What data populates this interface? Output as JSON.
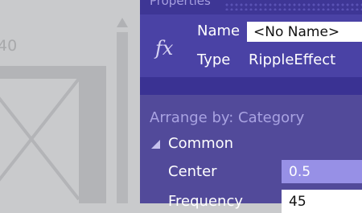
{
  "artboard": {
    "ruler_number": "40"
  },
  "panel": {
    "title": "Properties",
    "icon": "fx",
    "name_label": "Name",
    "name_value": "<No Name>",
    "type_label": "Type",
    "type_value": "RippleEffect",
    "arrange_by": "Arrange by: Category",
    "group": "Common",
    "properties": [
      {
        "label": "Center",
        "value": "0.5"
      },
      {
        "label": "Frequency",
        "value": "45"
      }
    ]
  },
  "colors": {
    "panel_bg": "#524a9a",
    "header_bg": "#4a42a5",
    "title_bar": "#3e3695",
    "highlight_field": "#9790e6",
    "canvas_bg": "#c9cacc"
  }
}
